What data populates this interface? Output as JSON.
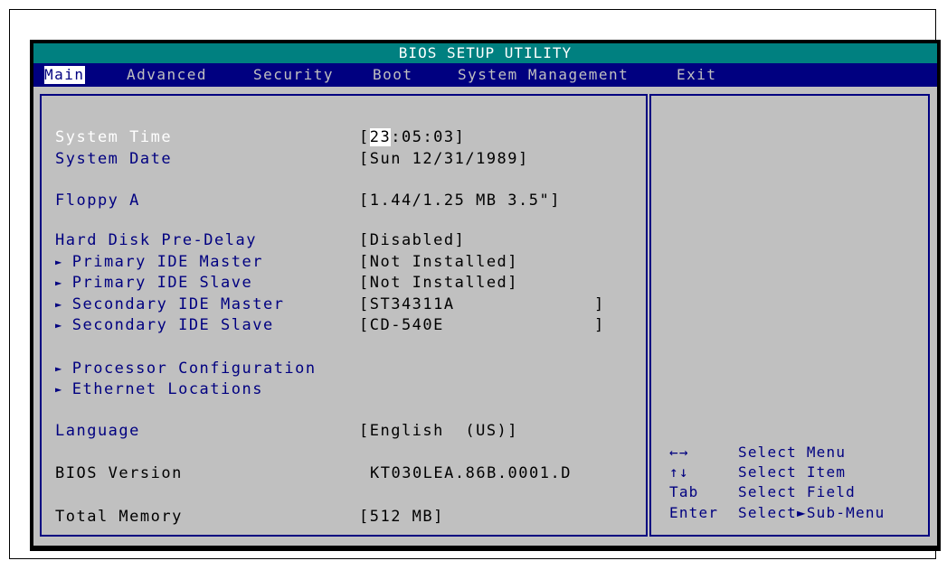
{
  "title": "BIOS SETUP UTILITY",
  "menu": [
    {
      "label": "Main",
      "active": true
    },
    {
      "label": "Advanced"
    },
    {
      "label": "Security"
    },
    {
      "label": "Boot"
    },
    {
      "label": "System Management"
    },
    {
      "label": "Exit"
    }
  ],
  "settings": {
    "system_time": {
      "label": "System Time",
      "value_open": "[",
      "value_hl": "23",
      "value_rest": ":05:03]"
    },
    "system_date": {
      "label": "System Date",
      "value": "[Sun 12/31/1989]"
    },
    "floppy_a": {
      "label": "Floppy A",
      "value": "[1.44/1.25 MB 3.5\"]"
    },
    "hard_disk_pre_delay": {
      "label": "Hard Disk Pre-Delay",
      "value": "[Disabled]"
    },
    "primary_ide_master": {
      "label": "Primary IDE Master",
      "value": "[Not Installed]"
    },
    "primary_ide_slave": {
      "label": "Primary IDE Slave",
      "value": "[Not Installed]"
    },
    "secondary_ide_master": {
      "label": "Secondary IDE Master",
      "value": "[ST34311A",
      "close": "]"
    },
    "secondary_ide_slave": {
      "label": "Secondary IDE Slave",
      "value": "[CD-540E",
      "close": "]"
    },
    "processor_configuration": {
      "label": "Processor Configuration"
    },
    "ethernet_locations": {
      "label": "Ethernet Locations"
    },
    "language": {
      "label": "Language",
      "value": "[English  (US)]"
    },
    "bios_version": {
      "label": "BIOS Version",
      "value": "KT030LEA.86B.0001.D"
    },
    "total_memory": {
      "label": "Total Memory",
      "value": "[512 MB]"
    }
  },
  "submenu_arrow": "►",
  "help": [
    {
      "key": "←→",
      "desc": "Select Menu"
    },
    {
      "key": "↑↓",
      "desc": "Select Item"
    },
    {
      "key": "Tab",
      "desc": "Select Field"
    },
    {
      "key": "Enter",
      "desc": "Select►Sub-Menu"
    }
  ],
  "colors": {
    "title_bar": "#008080",
    "menu_bar": "#000080",
    "panel": "#c0c0c0",
    "label_text": "#000080",
    "selected_text": "#ffffff"
  }
}
